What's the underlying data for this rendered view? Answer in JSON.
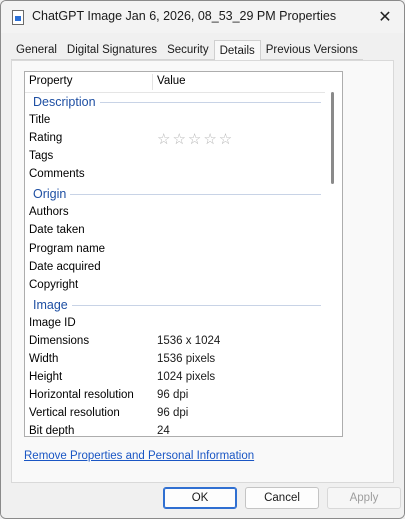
{
  "window": {
    "title": "ChatGPT Image Jan 6, 2026, 08_53_29 PM Properties",
    "close_glyph": "✕"
  },
  "tabs": [
    {
      "label": "General"
    },
    {
      "label": "Digital Signatures"
    },
    {
      "label": "Security"
    },
    {
      "label": "Details",
      "active": true
    },
    {
      "label": "Previous Versions"
    }
  ],
  "list": {
    "col_property": "Property",
    "col_value": "Value",
    "groups": {
      "description": "Description",
      "origin": "Origin",
      "image": "Image"
    },
    "description_rows": [
      {
        "p": "Title",
        "v": ""
      },
      {
        "p": "Rating",
        "v": ""
      },
      {
        "p": "Tags",
        "v": ""
      },
      {
        "p": "Comments",
        "v": ""
      }
    ],
    "rating_stars": "☆☆☆☆☆",
    "rating_value": 0,
    "origin_rows": [
      {
        "p": "Authors",
        "v": ""
      },
      {
        "p": "Date taken",
        "v": ""
      },
      {
        "p": "Program name",
        "v": ""
      },
      {
        "p": "Date acquired",
        "v": ""
      },
      {
        "p": "Copyright",
        "v": ""
      }
    ],
    "image_rows": [
      {
        "p": "Image ID",
        "v": ""
      },
      {
        "p": "Dimensions",
        "v": "1536 x 1024"
      },
      {
        "p": "Width",
        "v": "1536 pixels"
      },
      {
        "p": "Height",
        "v": "1024 pixels"
      },
      {
        "p": "Horizontal resolution",
        "v": "96 dpi"
      },
      {
        "p": "Vertical resolution",
        "v": "96 dpi"
      },
      {
        "p": "Bit depth",
        "v": "24"
      }
    ]
  },
  "link": "Remove Properties and Personal Information",
  "buttons": {
    "ok": "OK",
    "cancel": "Cancel",
    "apply": "Apply"
  },
  "colors": {
    "group_heading": "#1e4fa3",
    "link": "#1a56c4",
    "primary_border": "#2f6fd1"
  }
}
